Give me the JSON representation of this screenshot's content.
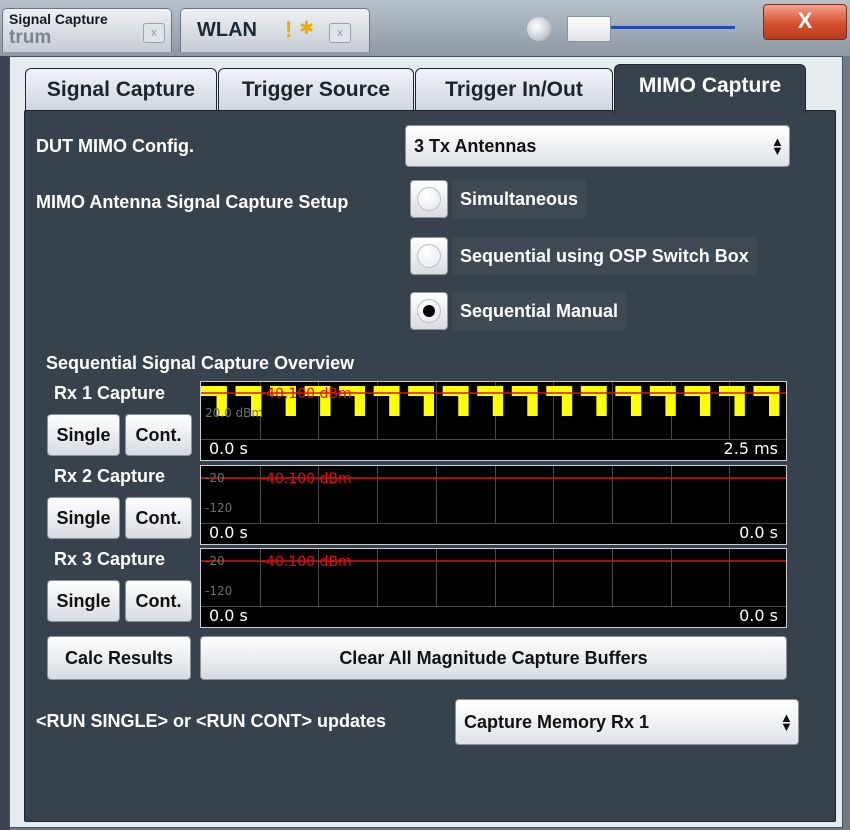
{
  "window": {
    "tabs": [
      {
        "label": "Signal Capture",
        "underlay": "trum"
      },
      {
        "label": "WLAN"
      }
    ],
    "close_label": "X"
  },
  "tabs": [
    "Signal Capture",
    "Trigger Source",
    "Trigger In/Out",
    "MIMO Capture"
  ],
  "active_tab": "MIMO Capture",
  "dut_mimo": {
    "label": "DUT MIMO Config.",
    "value": "3 Tx Antennas"
  },
  "capture_setup": {
    "label": "MIMO Antenna Signal Capture Setup",
    "options": [
      {
        "label": "Simultaneous",
        "selected": false
      },
      {
        "label": "Sequential using OSP Switch Box",
        "selected": false
      },
      {
        "label": "Sequential Manual",
        "selected": true
      }
    ]
  },
  "overview": {
    "title": "Sequential Signal Capture Overview",
    "captures": [
      {
        "label": "Rx 1 Capture",
        "single": "Single",
        "cont": "Cont.",
        "ref_level": "-40.100 dBm",
        "tick_top": "",
        "tick_bottom": "20.0 dBm",
        "start": "0.0 s",
        "end": "2.5 ms",
        "has_signal": true
      },
      {
        "label": "Rx 2 Capture",
        "single": "Single",
        "cont": "Cont.",
        "ref_level": "-40.100 dBm",
        "tick_top": "-20",
        "tick_bottom": "-120",
        "start": "0.0 s",
        "end": "0.0 s",
        "has_signal": false
      },
      {
        "label": "Rx 3 Capture",
        "single": "Single",
        "cont": "Cont.",
        "ref_level": "-40.100 dBm",
        "tick_top": "-20",
        "tick_bottom": "-120",
        "start": "0.0 s",
        "end": "0.0 s",
        "has_signal": false
      }
    ]
  },
  "buttons": {
    "calc_results": "Calc Results",
    "clear_all": "Clear All Magnitude Capture Buffers"
  },
  "updates": {
    "label": "<RUN SINGLE> or <RUN CONT> updates",
    "value": "Capture Memory Rx 1"
  },
  "colors": {
    "panel": "#38424c",
    "trace": "#ffff00",
    "ref_line": "#e01010",
    "plot_bg": "#000000"
  }
}
